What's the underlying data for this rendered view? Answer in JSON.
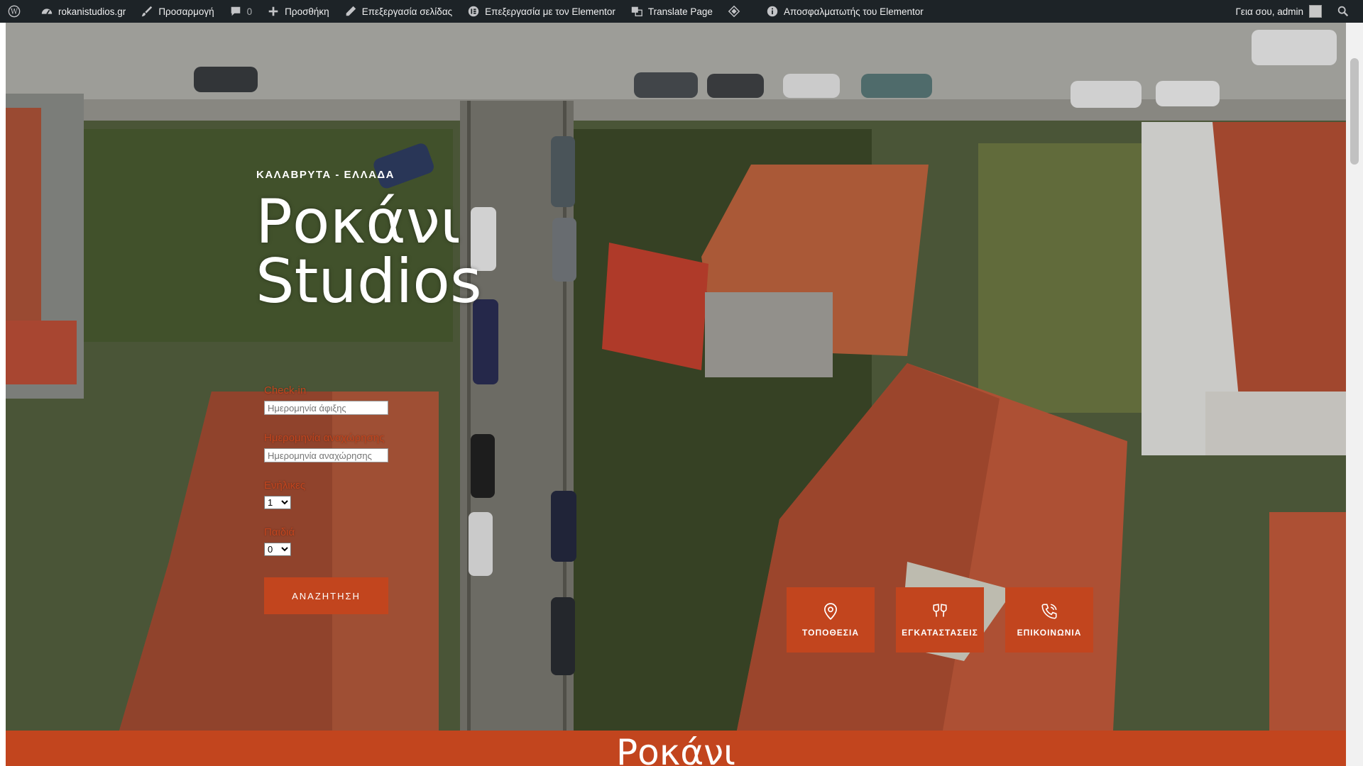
{
  "adminbar": {
    "wp_icon": "wordpress-icon",
    "site": "rokanistudios.gr",
    "customize": "Προσαρμογή",
    "comments": "0",
    "new": "Προσθήκη",
    "edit_page": "Επεξεργασία σελίδας",
    "edit_elementor": "Επεξεργασία με τον Elementor",
    "translate": "Translate Page",
    "debugger": "Αποσφαλματωτής του Elementor",
    "greeting": "Γεια σου, admin"
  },
  "hero": {
    "eyebrow": "ΚΑΛΑΒΡΥΤΑ - ΕΛΛΑΔΑ",
    "title_line1": "Ροκάνι",
    "title_line2": "Studios"
  },
  "booking": {
    "checkin_label": "Check-in",
    "checkin_placeholder": "Ημερομηνία άφιξης",
    "checkout_label": "Ημερομηνία αναχώρησης",
    "checkout_placeholder": "Ημερομηνία αναχώρησης",
    "adults_label": "Ενήλικες",
    "adults_value": "1",
    "children_label": "Παιδιά",
    "children_value": "0",
    "search_button": "ΑΝΑΖΗΤΗΣΗ"
  },
  "tiles": [
    {
      "label": "ΤΟΠΟΘΕΣΙΑ",
      "icon": "location-pin-icon"
    },
    {
      "label": "ΕΓΚΑΤΑΣΤΑΣΕΙΣ",
      "icon": "cheers-glasses-icon"
    },
    {
      "label": "ΕΠΙΚΟΙΝΩΝΙΑ",
      "icon": "phone-icon"
    }
  ],
  "footer": {
    "title": "Ροκάνι"
  },
  "colors": {
    "accent": "#c2451e",
    "adminbar": "#1d2327"
  }
}
